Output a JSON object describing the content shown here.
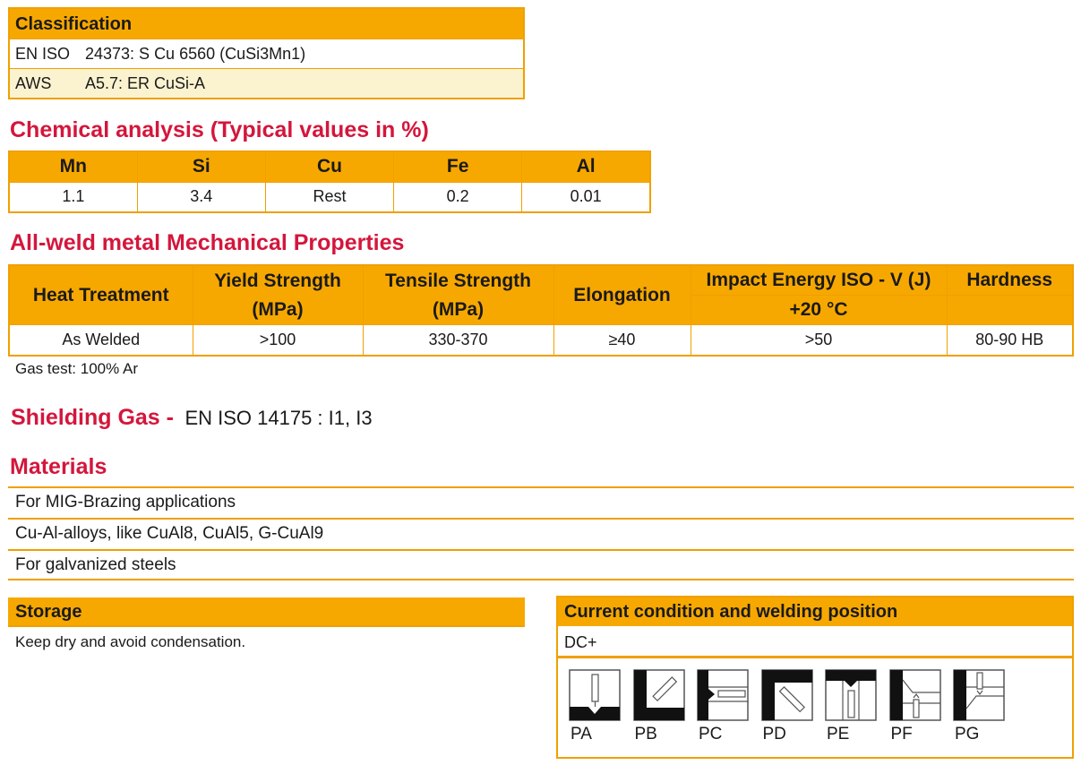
{
  "classification": {
    "title": "Classification",
    "rows": [
      {
        "key": "EN ISO",
        "value": "24373: S Cu 6560 (CuSi3Mn1)"
      },
      {
        "key": "AWS",
        "value": "A5.7: ER CuSi-A"
      }
    ]
  },
  "chemical": {
    "title": "Chemical analysis (Typical values in %)",
    "headers": [
      "Mn",
      "Si",
      "Cu",
      "Fe",
      "Al"
    ],
    "values": [
      "1.1",
      "3.4",
      "Rest",
      "0.2",
      "0.01"
    ]
  },
  "mechanical": {
    "title": "All-weld metal Mechanical Properties",
    "headers": {
      "heat_treatment": "Heat Treatment",
      "yield_1": "Yield Strength",
      "yield_2": "(MPa)",
      "tensile_1": "Tensile Strength",
      "tensile_2": "(MPa)",
      "elongation": "Elongation",
      "impact": "Impact Energy ISO - V (J)",
      "impact_temp": "+20 °C",
      "hardness": "Hardness"
    },
    "row": {
      "heat_treatment": "As Welded",
      "yield": ">100",
      "tensile": "330-370",
      "elongation": "≥40",
      "impact": ">50",
      "hardness": "80-90 HB"
    },
    "note": "Gas test: 100% Ar"
  },
  "shielding_gas": {
    "label": "Shielding Gas -",
    "value": "EN ISO 14175 : I1, I3"
  },
  "materials": {
    "title": "Materials",
    "items": [
      "For MIG-Brazing applications",
      "Cu-Al-alloys, like CuAl8, CuAl5, G-CuAl9",
      "For galvanized steels"
    ]
  },
  "storage": {
    "title": "Storage",
    "text": "Keep dry and avoid condensation."
  },
  "current": {
    "title": "Current condition and welding position",
    "polarity": "DC+",
    "positions": [
      {
        "label": "PA",
        "icon": "position-pa-icon"
      },
      {
        "label": "PB",
        "icon": "position-pb-icon"
      },
      {
        "label": "PC",
        "icon": "position-pc-icon"
      },
      {
        "label": "PD",
        "icon": "position-pd-icon"
      },
      {
        "label": "PE",
        "icon": "position-pe-icon"
      },
      {
        "label": "PF",
        "icon": "position-pf-icon"
      },
      {
        "label": "PG",
        "icon": "position-pg-icon"
      }
    ]
  },
  "colors": {
    "accent": "#f7a800",
    "title_red": "#d4163c",
    "row_alt": "#fbf3d0"
  }
}
